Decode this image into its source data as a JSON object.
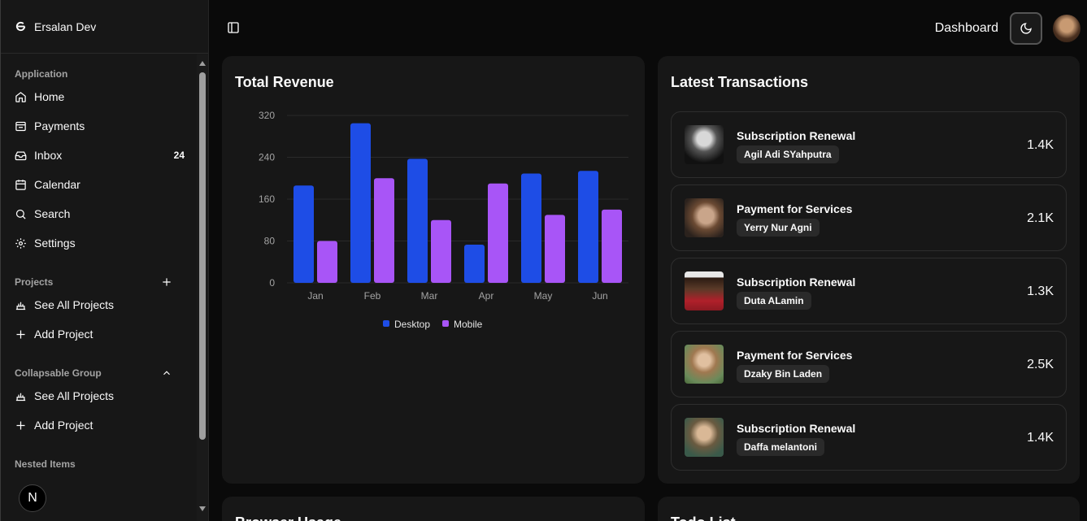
{
  "brand": {
    "name": "Ersalan Dev"
  },
  "sidebar": {
    "application": {
      "label": "Application",
      "items": [
        {
          "label": "Home",
          "icon": "home-icon"
        },
        {
          "label": "Payments",
          "icon": "wallet-icon"
        },
        {
          "label": "Inbox",
          "icon": "inbox-icon",
          "badge": "24"
        },
        {
          "label": "Calendar",
          "icon": "calendar-icon"
        },
        {
          "label": "Search",
          "icon": "search-icon"
        },
        {
          "label": "Settings",
          "icon": "gear-icon"
        }
      ]
    },
    "projects": {
      "label": "Projects",
      "items": [
        {
          "label": "See All Projects",
          "icon": "projects-icon"
        },
        {
          "label": "Add Project",
          "icon": "plus-icon"
        }
      ]
    },
    "collapsable": {
      "label": "Collapsable Group",
      "items": [
        {
          "label": "See All Projects",
          "icon": "projects-icon"
        },
        {
          "label": "Add Project",
          "icon": "plus-icon"
        }
      ]
    },
    "nested": {
      "label": "Nested Items"
    },
    "next_badge": "N"
  },
  "header": {
    "title": "Dashboard"
  },
  "revenue": {
    "title": "Total Revenue"
  },
  "chart_data": {
    "type": "bar",
    "categories": [
      "Jan",
      "Feb",
      "Mar",
      "Apr",
      "May",
      "Jun"
    ],
    "series": [
      {
        "name": "Desktop",
        "color": "#1e4de6",
        "values": [
          186,
          305,
          237,
          73,
          209,
          214
        ]
      },
      {
        "name": "Mobile",
        "color": "#a855f7",
        "values": [
          80,
          200,
          120,
          190,
          130,
          140
        ]
      }
    ],
    "yticks": [
      "0",
      "80",
      "160",
      "240",
      "320"
    ],
    "ylim": [
      0,
      320
    ],
    "grid": true,
    "legend": "bottom"
  },
  "transactions": {
    "title": "Latest Transactions",
    "items": [
      {
        "title": "Subscription Renewal",
        "name": "Agil Adi SYahputra",
        "amount": "1.4K"
      },
      {
        "title": "Payment for Services",
        "name": "Yerry Nur Agni",
        "amount": "2.1K"
      },
      {
        "title": "Subscription Renewal",
        "name": "Duta ALamin",
        "amount": "1.3K"
      },
      {
        "title": "Payment for Services",
        "name": "Dzaky Bin Laden",
        "amount": "2.5K"
      },
      {
        "title": "Subscription Renewal",
        "name": "Daffa melantoni",
        "amount": "1.4K"
      }
    ]
  },
  "browser": {
    "title": "Browser Usage"
  },
  "todo": {
    "title": "Todo List"
  }
}
